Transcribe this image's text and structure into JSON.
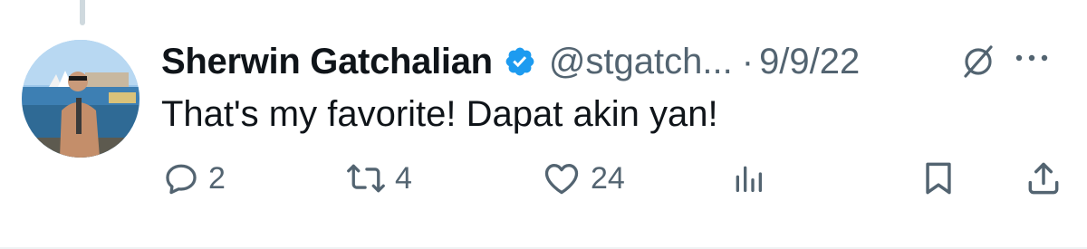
{
  "tweet": {
    "author_name": "Sherwin Gatchalian",
    "handle": "@stgatch...",
    "separator": "·",
    "date": "9/9/22",
    "text": "That's my favorite! Dapat akin yan!",
    "verified": true
  },
  "actions": {
    "replies": "2",
    "retweets": "4",
    "likes": "24"
  },
  "icons": {
    "verified": "verified-badge-icon",
    "grok": "grok-icon",
    "more": "more-options-icon",
    "reply": "reply-icon",
    "retweet": "retweet-icon",
    "like": "heart-icon",
    "views": "views-chart-icon",
    "bookmark": "bookmark-icon",
    "share": "share-icon"
  },
  "colors": {
    "accent": "#1d9bf0",
    "text_primary": "#0f1419",
    "text_secondary": "#536471"
  }
}
